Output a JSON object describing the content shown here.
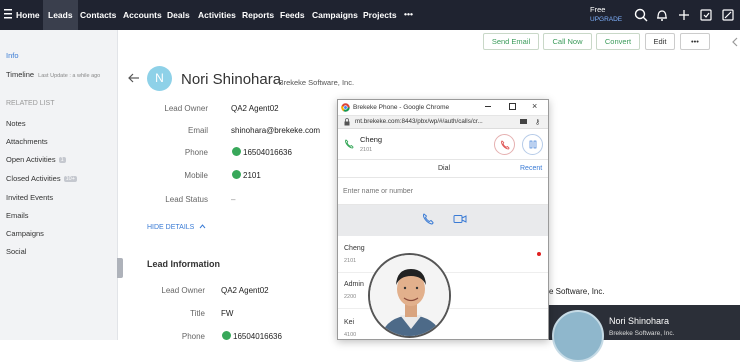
{
  "nav": {
    "items": [
      "Home",
      "Leads",
      "Contacts",
      "Accounts",
      "Deals",
      "Activities",
      "Reports",
      "Feeds",
      "Campaigns",
      "Projects"
    ],
    "more": "•••",
    "plan": "Free",
    "upgrade": "UPGRADE"
  },
  "actions": {
    "send_email": "Send Email",
    "call_now": "Call Now",
    "convert": "Convert",
    "edit": "Edit",
    "more": "•••"
  },
  "sidebar": {
    "info": "Info",
    "timeline": "Timeline",
    "timeline_note": "Last Update : a while ago",
    "related_heading": "RELATED LIST",
    "items": [
      {
        "label": "Notes"
      },
      {
        "label": "Attachments"
      },
      {
        "label": "Open Activities",
        "badge": "1"
      },
      {
        "label": "Closed Activities",
        "badge": "10+"
      },
      {
        "label": "Invited Events"
      },
      {
        "label": "Emails"
      },
      {
        "label": "Campaigns"
      },
      {
        "label": "Social"
      }
    ]
  },
  "lead": {
    "avatar_initial": "N",
    "name": "Nori Shinohara",
    "company": "- Brekeke Software, Inc.",
    "fields": [
      {
        "label": "Lead Owner",
        "value": "QA2 Agent02"
      },
      {
        "label": "Email",
        "value": "shinohara@brekeke.com"
      },
      {
        "label": "Phone",
        "value": "16504016636"
      },
      {
        "label": "Mobile",
        "value": "2101"
      },
      {
        "label": "Lead Status",
        "value": "–"
      }
    ],
    "hide_details": "HIDE DETAILS",
    "section_title": "Lead Information",
    "info_fields": [
      {
        "label": "Lead Owner",
        "value": "QA2 Agent02"
      },
      {
        "label": "Title",
        "value": "FW"
      },
      {
        "label": "Phone",
        "value": "16504016636"
      }
    ],
    "company_partial": "e Software, Inc."
  },
  "popup": {
    "window_title": "Brekeke Phone - Google Chrome",
    "url": "mt.brekeke.com:8443/pbx/wp/#/auth/calls/cr...",
    "current_call_name": "Cheng",
    "current_call_ext": "2101",
    "dial_tab": "Dial",
    "recent_tab": "Recent",
    "search_placeholder": "Enter name or number",
    "contacts": [
      {
        "name": "Cheng",
        "ext": "2101"
      },
      {
        "name": "Admin",
        "ext": "2200"
      },
      {
        "name": "Kei",
        "ext": "4100"
      }
    ],
    "colors": {
      "accent": "#3a7bd5",
      "hangup": "#e05a5a",
      "online": "#e02020"
    }
  },
  "card": {
    "name": "Nori Shinohara",
    "company": "Brekeke Software, Inc."
  }
}
